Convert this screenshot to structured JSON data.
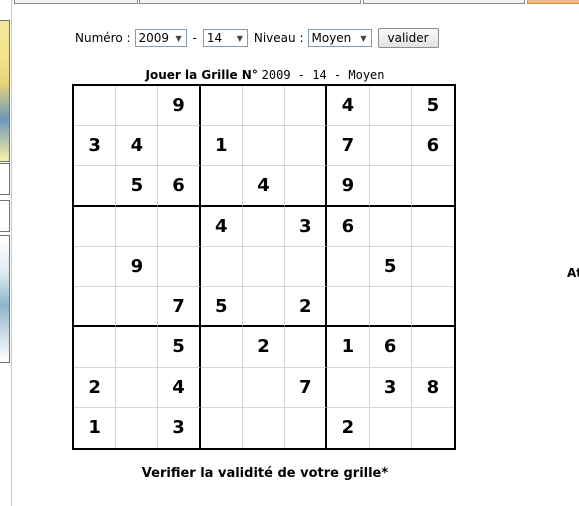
{
  "form": {
    "numero_label": "Numéro :",
    "year_value": "2009",
    "separator": "-",
    "number_value": "14",
    "niveau_label": "Niveau :",
    "level_value": "Moyen",
    "submit_label": "valider"
  },
  "caption": {
    "prefix": "Jouer la Grille N°",
    "info": "2009 - 14 - Moyen"
  },
  "grid": [
    [
      "",
      "",
      "9",
      "",
      "",
      "",
      "4",
      "",
      "5"
    ],
    [
      "3",
      "4",
      "",
      "1",
      "",
      "",
      "7",
      "",
      "6"
    ],
    [
      "",
      "5",
      "6",
      "",
      "4",
      "",
      "9",
      "",
      ""
    ],
    [
      "",
      "",
      "",
      "4",
      "",
      "3",
      "6",
      "",
      ""
    ],
    [
      "",
      "9",
      "",
      "",
      "",
      "",
      "",
      "5",
      ""
    ],
    [
      "",
      "",
      "7",
      "5",
      "",
      "2",
      "",
      "",
      ""
    ],
    [
      "",
      "",
      "5",
      "",
      "2",
      "",
      "1",
      "6",
      ""
    ],
    [
      "2",
      "",
      "4",
      "",
      "",
      "7",
      "",
      "3",
      "8"
    ],
    [
      "1",
      "",
      "3",
      "",
      "",
      "",
      "2",
      "",
      ""
    ]
  ],
  "verify_label": "Verifier la validité de votre grille*",
  "side_text": "At",
  "colors": {
    "thick_border": "#000000",
    "thin_border": "#d4d4d4",
    "select_border": "#7f9db9",
    "tab_accent": "#f2b988"
  }
}
